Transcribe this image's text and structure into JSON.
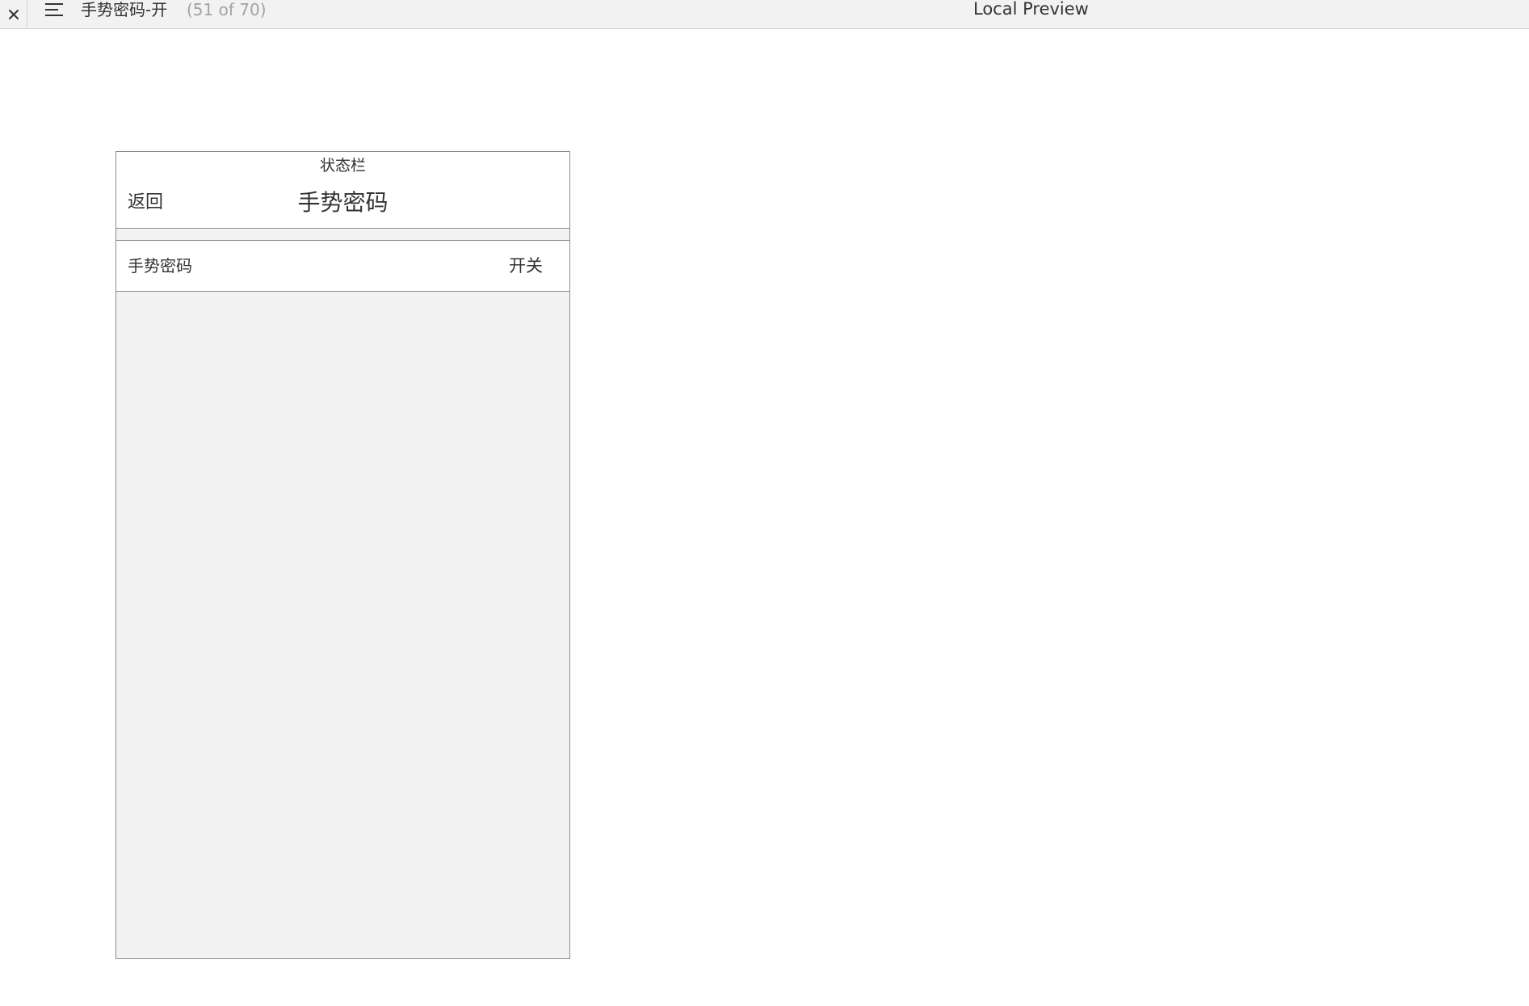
{
  "toolbar": {
    "close_icon": "close-icon",
    "menu_icon": "menu-icon",
    "page_title": "手势密码-开",
    "page_count": "(51 of 70)",
    "preview_label": "Local Preview"
  },
  "phone": {
    "status_bar": "状态栏",
    "nav": {
      "back_label": "返回",
      "title": "手势密码"
    },
    "setting": {
      "label": "手势密码",
      "toggle_label": "开关"
    }
  },
  "colors": {
    "toolbar_bg": "#f2f2f2",
    "border": "#8c8c8c",
    "page_bg": "#f2f2f2",
    "text": "#333333",
    "muted_text": "#a3a3a3"
  }
}
